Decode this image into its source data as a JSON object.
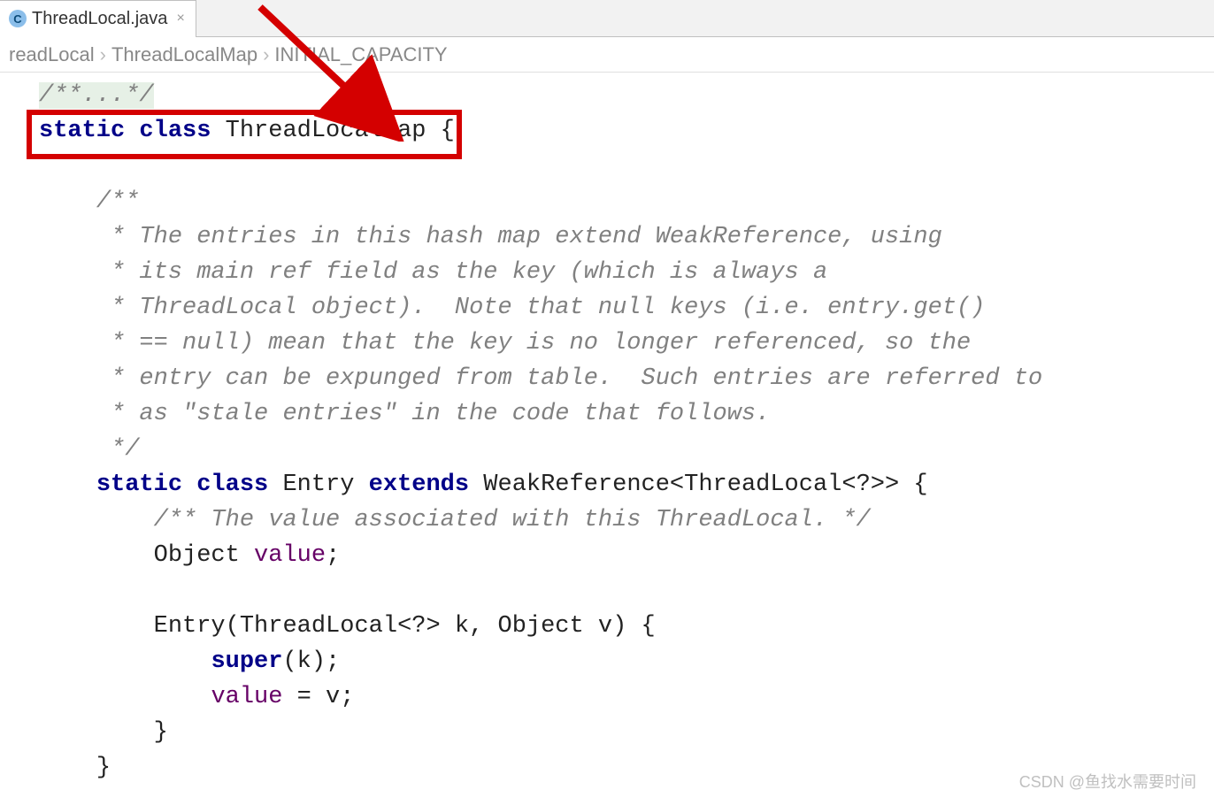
{
  "tab": {
    "label": "ThreadLocal.java",
    "icon_letter": "C",
    "close_glyph": "×"
  },
  "breadcrumb": {
    "item0": "readLocal",
    "item1": "ThreadLocalMap",
    "item2": "INITIAL_CAPACITY",
    "sep": "›"
  },
  "code": {
    "fold": "/**...*/",
    "l1a": "static",
    "l1b": "class",
    "l1c": "ThreadLocalMap",
    "l1d": " {",
    "c1": "/**",
    "c2": " * The entries in this hash map extend WeakReference, using",
    "c3": " * its main ref field as the key (which is always a",
    "c4": " * ThreadLocal object).  Note that null keys (i.e. entry.get()",
    "c5": " * == null) mean that the key is no longer referenced, so the",
    "c6": " * entry can be expunged from table.  Such entries are referred to",
    "c7": " * as \"stale entries\" in the code that follows.",
    "c8": " */",
    "l2a": "static",
    "l2b": "class",
    "l2c": " Entry ",
    "l2d": "extends",
    "l2e": " WeakReference<ThreadLocal<?>> {",
    "c9": "/** The value associated with this ThreadLocal. */",
    "l3a": "Object ",
    "l3b": "value",
    "l3c": ";",
    "l4": "Entry(ThreadLocal<?> k, Object v) {",
    "l5a": "super",
    "l5b": "(k);",
    "l6a": "value",
    "l6b": " = v;",
    "l7": "}",
    "l8": "}"
  },
  "watermark": "CSDN @鱼找水需要时间"
}
